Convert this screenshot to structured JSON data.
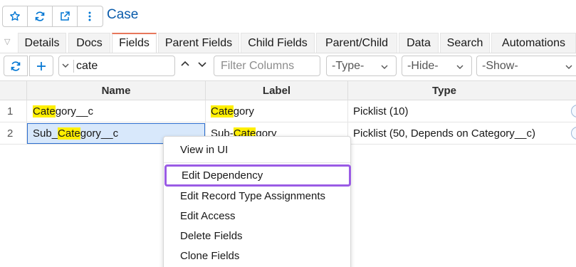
{
  "header": {
    "title": "Case",
    "icons": [
      "star-icon",
      "refresh-icon",
      "external-link-icon",
      "more-vertical-icon"
    ]
  },
  "tabs": [
    {
      "label": "Details"
    },
    {
      "label": "Docs"
    },
    {
      "label": "Fields"
    },
    {
      "label": "Parent Fields"
    },
    {
      "label": "Child Fields"
    },
    {
      "label": "Parent/Child"
    },
    {
      "label": "Data"
    },
    {
      "label": "Search"
    },
    {
      "label": "Automations"
    }
  ],
  "active_tab": "Fields",
  "toolbar": {
    "filter_value": "cate",
    "filter_columns_placeholder": "Filter Columns",
    "type_select": "-Type-",
    "hide_select": "-Hide-",
    "show_select": "-Show-"
  },
  "grid": {
    "columns": [
      "Name",
      "Label",
      "Type"
    ],
    "rows": [
      {
        "num": "1",
        "name_pre": "",
        "name_hl": "Cate",
        "name_post": "gory__c",
        "label_pre": "",
        "label_hl": "Cate",
        "label_post": "gory",
        "type": "Picklist (10)"
      },
      {
        "num": "2",
        "name_pre": "Sub_",
        "name_hl": "Cate",
        "name_post": "gory__c",
        "label_pre": "Sub-",
        "label_hl": "Cate",
        "label_post": "gory",
        "type": "Picklist (50, Depends on Category__c)"
      }
    ]
  },
  "context_menu": {
    "items": [
      {
        "label": "View in UI"
      },
      {
        "label": "Edit Dependency"
      },
      {
        "label": "Edit Record Type Assignments"
      },
      {
        "label": "Edit Access"
      },
      {
        "label": "Delete Fields"
      },
      {
        "label": "Clone Fields"
      }
    ],
    "highlighted": "Edit Dependency"
  },
  "colors": {
    "accent": "#0176d3",
    "title": "#0b5cab",
    "highlight": "#ffef00",
    "selection": "#d8e8fb",
    "menu_focus": "#9a5be5",
    "active_tab": "#e8775b"
  }
}
